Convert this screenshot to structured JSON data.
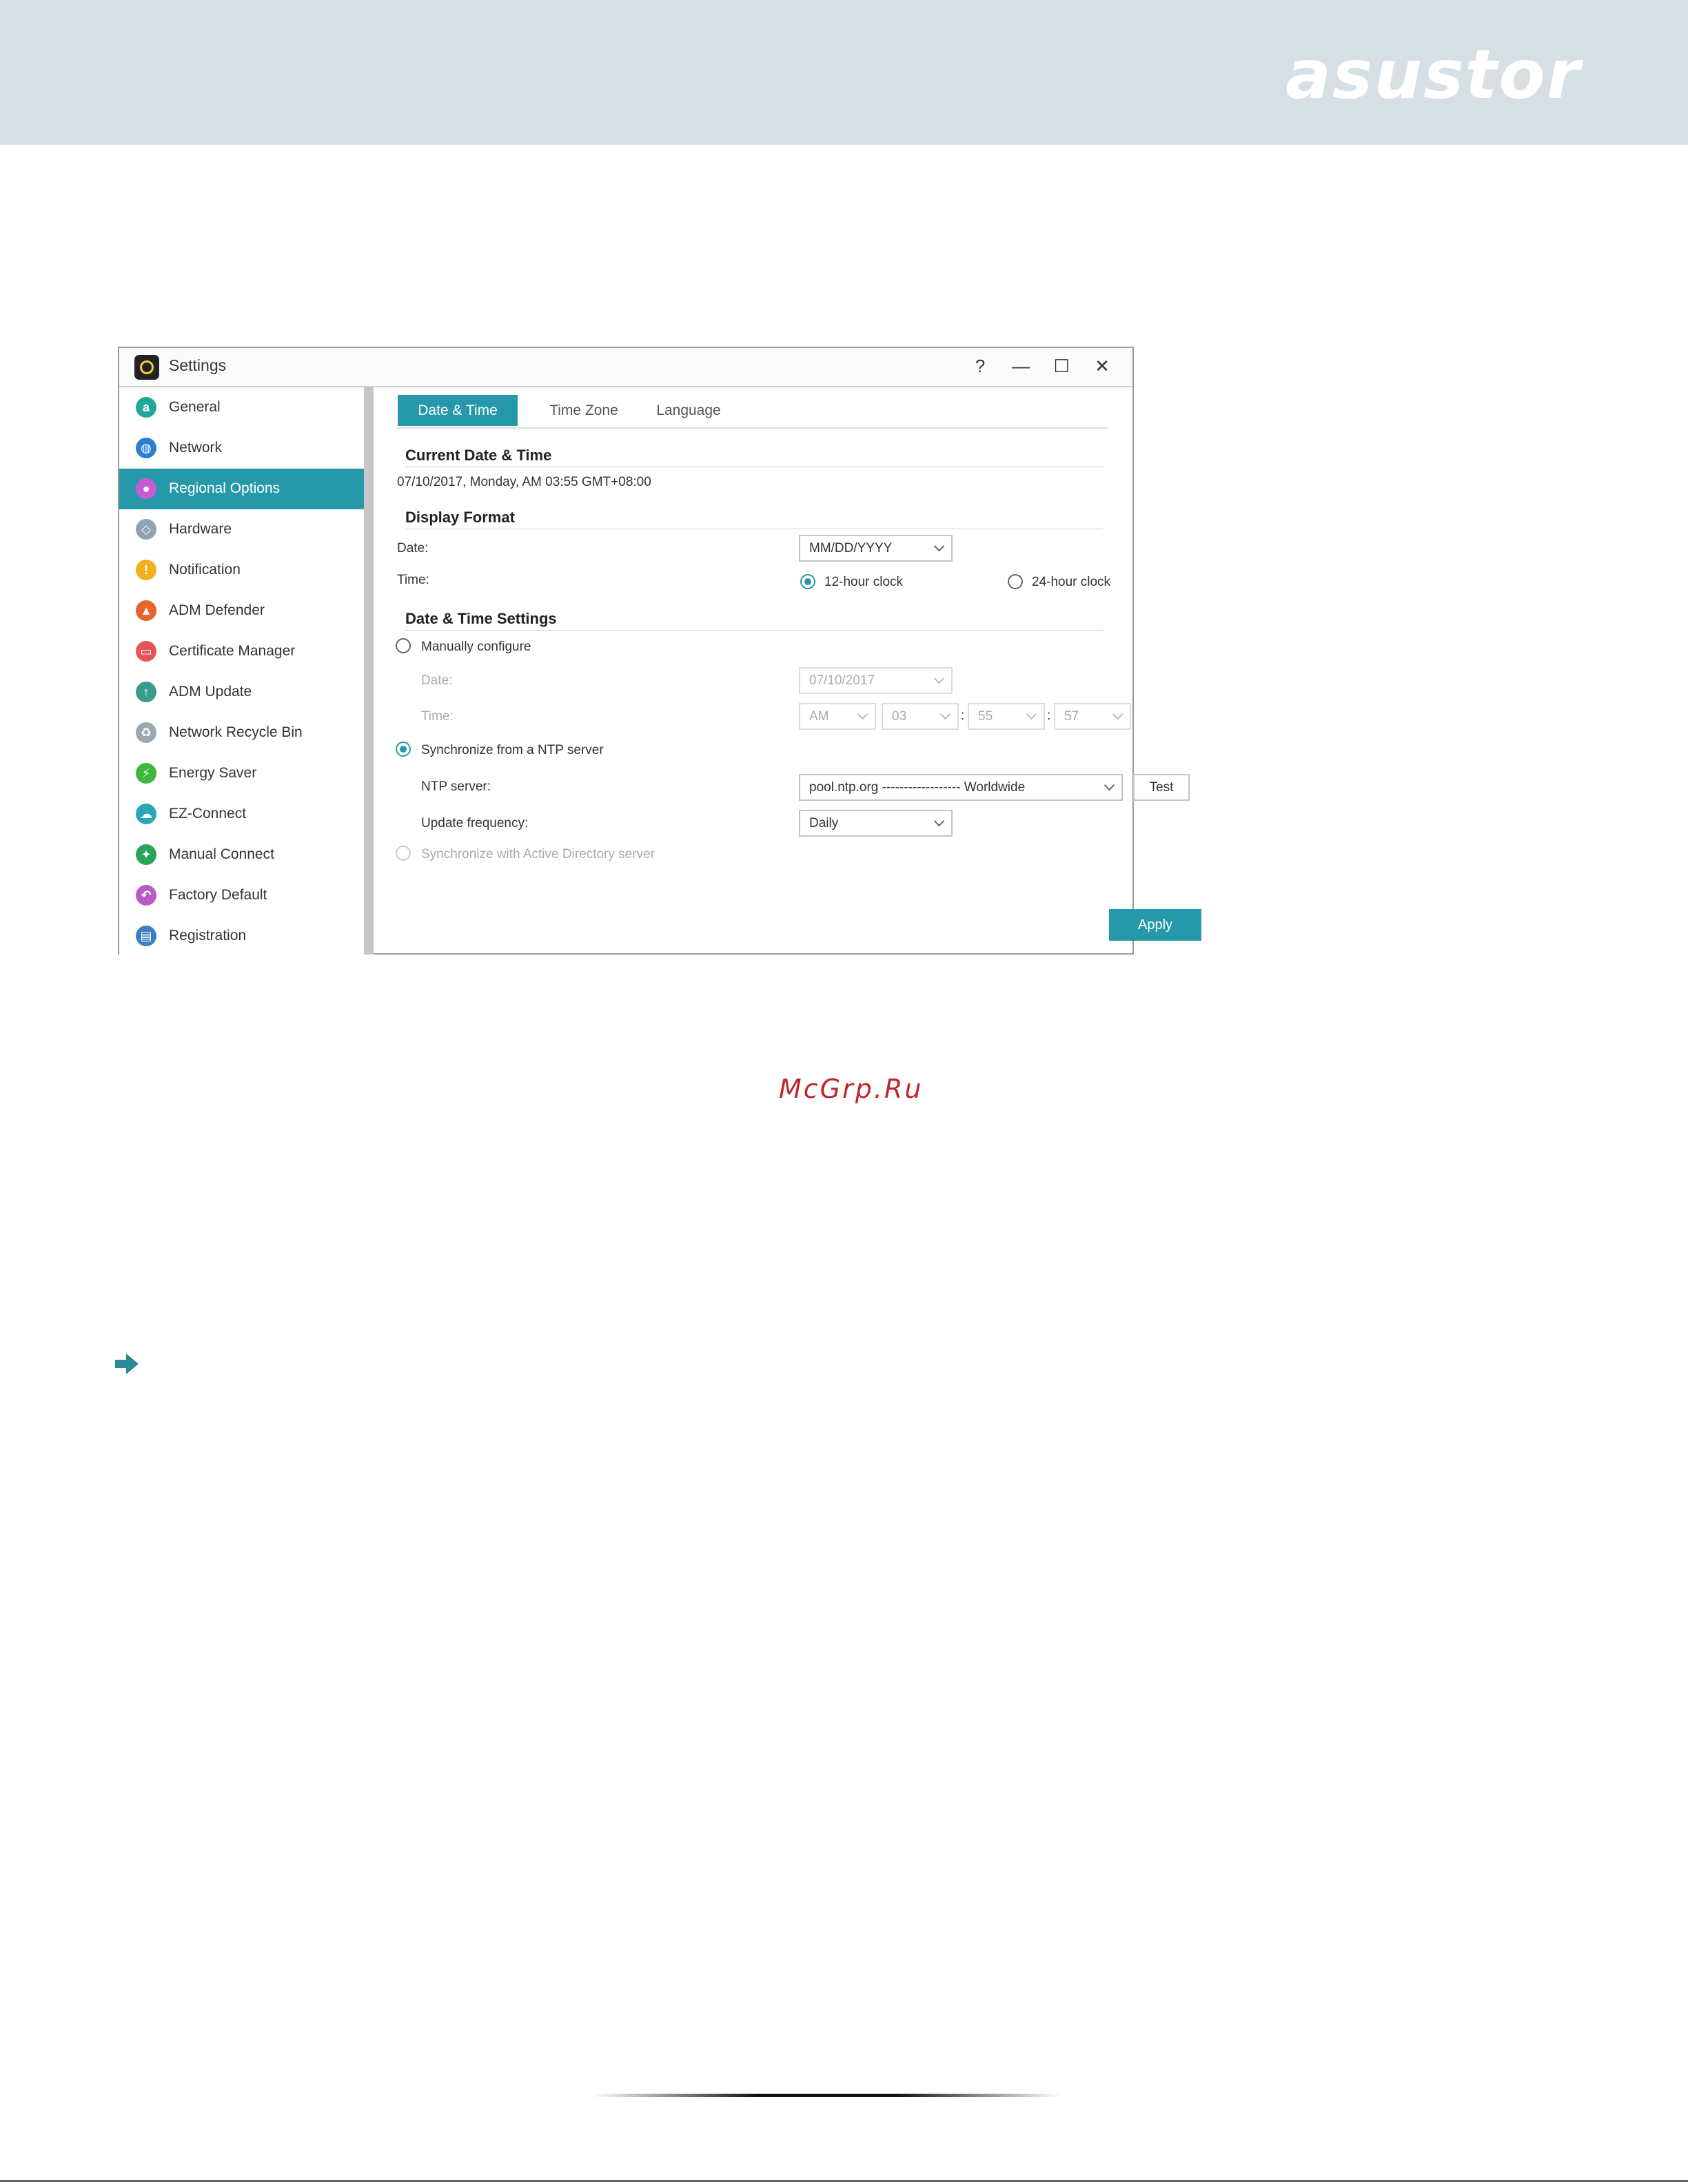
{
  "brand": "asustor",
  "window": {
    "title": "Settings",
    "controls": {
      "help": "?",
      "minimize": "—",
      "maximize": "☐",
      "close": "✕"
    }
  },
  "sidebar": {
    "items": [
      {
        "label": "General",
        "icon": "general-icon",
        "color": "#1fa89a"
      },
      {
        "label": "Network",
        "icon": "globe-icon",
        "color": "#2b7fd1"
      },
      {
        "label": "Regional Options",
        "icon": "location-pin-icon",
        "color": "#c75bd6"
      },
      {
        "label": "Hardware",
        "icon": "hardware-icon",
        "color": "#8fa3b5"
      },
      {
        "label": "Notification",
        "icon": "alert-icon",
        "color": "#f2b01e"
      },
      {
        "label": "ADM Defender",
        "icon": "firewall-icon",
        "color": "#e8642c"
      },
      {
        "label": "Certificate Manager",
        "icon": "certificate-icon",
        "color": "#e6545a"
      },
      {
        "label": "ADM Update",
        "icon": "update-icon",
        "color": "#3a9b8f"
      },
      {
        "label": "Network Recycle Bin",
        "icon": "recycle-bin-icon",
        "color": "#9aa8b0"
      },
      {
        "label": "Energy Saver",
        "icon": "energy-icon",
        "color": "#3db83d"
      },
      {
        "label": "EZ-Connect",
        "icon": "cloud-icon",
        "color": "#2ba6b8"
      },
      {
        "label": "Manual Connect",
        "icon": "manual-connect-icon",
        "color": "#27a55a"
      },
      {
        "label": "Factory Default",
        "icon": "undo-icon",
        "color": "#b85bc7"
      },
      {
        "label": "Registration",
        "icon": "registration-icon",
        "color": "#3a7fc4"
      }
    ],
    "active_index": 2
  },
  "tabs": [
    {
      "label": "Date & Time"
    },
    {
      "label": "Time Zone"
    },
    {
      "label": "Language"
    }
  ],
  "current": {
    "heading": "Current Date & Time",
    "value": "07/10/2017, Monday, AM 03:55 GMT+08:00"
  },
  "display_format": {
    "heading": "Display Format",
    "date_label": "Date:",
    "date_value": "MM/DD/YYYY",
    "time_label": "Time:",
    "clock12": "12-hour clock",
    "clock24": "24-hour clock"
  },
  "settings": {
    "heading": "Date & Time Settings",
    "manual_label": "Manually configure",
    "manual_date_label": "Date:",
    "manual_date_value": "07/10/2017",
    "manual_time_label": "Time:",
    "ampm": "AM",
    "hour": "03",
    "minute": "55",
    "second": "57",
    "colon": ":",
    "ntp_label": "Synchronize from a NTP server",
    "ntp_server_label": "NTP server:",
    "ntp_server_value": "pool.ntp.org ------------------ Worldwide",
    "test_label": "Test",
    "update_freq_label": "Update frequency:",
    "update_freq_value": "Daily",
    "ad_label": "Synchronize with Active Directory server"
  },
  "apply_label": "Apply",
  "watermark": "McGrp.Ru",
  "accent_color": "#2598a9"
}
